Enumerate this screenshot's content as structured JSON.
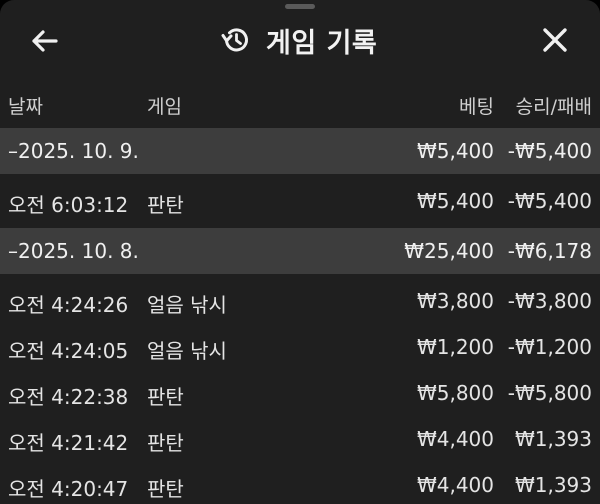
{
  "header": {
    "title": "게임 기록",
    "back_icon": "arrow-left-icon",
    "history_icon": "history-icon",
    "close_icon": "close-icon"
  },
  "columns": {
    "date": "날짜",
    "game": "게임",
    "bet": "베팅",
    "result": "승리/패배"
  },
  "rows": [
    {
      "type": "group",
      "date": "–2025. 10. 9.",
      "game": "",
      "bet": "₩5,400",
      "result": "-₩5,400"
    },
    {
      "type": "item",
      "date": "오전 6:03:12",
      "game": "판탄",
      "bet": "₩5,400",
      "result": "-₩5,400"
    },
    {
      "type": "group",
      "date": "–2025. 10. 8.",
      "game": "",
      "bet": "₩25,400",
      "result": "-₩6,178"
    },
    {
      "type": "item",
      "date": "오전 4:24:26",
      "game": "얼음 낚시",
      "bet": "₩3,800",
      "result": "-₩3,800"
    },
    {
      "type": "item",
      "date": "오전 4:24:05",
      "game": "얼음 낚시",
      "bet": "₩1,200",
      "result": "-₩1,200"
    },
    {
      "type": "item",
      "date": "오전 4:22:38",
      "game": "판탄",
      "bet": "₩5,800",
      "result": "-₩5,800"
    },
    {
      "type": "item",
      "date": "오전 4:21:42",
      "game": "판탄",
      "bet": "₩4,400",
      "result": "₩1,393"
    },
    {
      "type": "item",
      "date": "오전 4:20:47",
      "game": "판탄",
      "bet": "₩4,400",
      "result": "₩1,393"
    }
  ],
  "colors": {
    "background": "#1f1f1f",
    "group_row": "#3d3d3d",
    "text": "#e4e4e4"
  }
}
